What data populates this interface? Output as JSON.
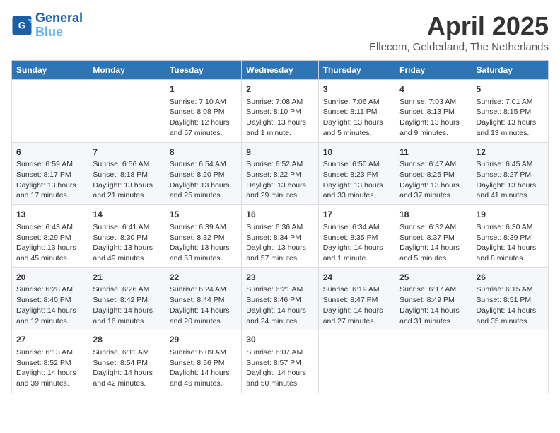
{
  "header": {
    "logo_line1": "General",
    "logo_line2": "Blue",
    "title": "April 2025",
    "location": "Ellecom, Gelderland, The Netherlands"
  },
  "weekdays": [
    "Sunday",
    "Monday",
    "Tuesday",
    "Wednesday",
    "Thursday",
    "Friday",
    "Saturday"
  ],
  "weeks": [
    [
      {
        "day": "",
        "info": ""
      },
      {
        "day": "",
        "info": ""
      },
      {
        "day": "1",
        "info": "Sunrise: 7:10 AM\nSunset: 8:08 PM\nDaylight: 12 hours and 57 minutes."
      },
      {
        "day": "2",
        "info": "Sunrise: 7:08 AM\nSunset: 8:10 PM\nDaylight: 13 hours and 1 minute."
      },
      {
        "day": "3",
        "info": "Sunrise: 7:06 AM\nSunset: 8:11 PM\nDaylight: 13 hours and 5 minutes."
      },
      {
        "day": "4",
        "info": "Sunrise: 7:03 AM\nSunset: 8:13 PM\nDaylight: 13 hours and 9 minutes."
      },
      {
        "day": "5",
        "info": "Sunrise: 7:01 AM\nSunset: 8:15 PM\nDaylight: 13 hours and 13 minutes."
      }
    ],
    [
      {
        "day": "6",
        "info": "Sunrise: 6:59 AM\nSunset: 8:17 PM\nDaylight: 13 hours and 17 minutes."
      },
      {
        "day": "7",
        "info": "Sunrise: 6:56 AM\nSunset: 8:18 PM\nDaylight: 13 hours and 21 minutes."
      },
      {
        "day": "8",
        "info": "Sunrise: 6:54 AM\nSunset: 8:20 PM\nDaylight: 13 hours and 25 minutes."
      },
      {
        "day": "9",
        "info": "Sunrise: 6:52 AM\nSunset: 8:22 PM\nDaylight: 13 hours and 29 minutes."
      },
      {
        "day": "10",
        "info": "Sunrise: 6:50 AM\nSunset: 8:23 PM\nDaylight: 13 hours and 33 minutes."
      },
      {
        "day": "11",
        "info": "Sunrise: 6:47 AM\nSunset: 8:25 PM\nDaylight: 13 hours and 37 minutes."
      },
      {
        "day": "12",
        "info": "Sunrise: 6:45 AM\nSunset: 8:27 PM\nDaylight: 13 hours and 41 minutes."
      }
    ],
    [
      {
        "day": "13",
        "info": "Sunrise: 6:43 AM\nSunset: 8:29 PM\nDaylight: 13 hours and 45 minutes."
      },
      {
        "day": "14",
        "info": "Sunrise: 6:41 AM\nSunset: 8:30 PM\nDaylight: 13 hours and 49 minutes."
      },
      {
        "day": "15",
        "info": "Sunrise: 6:39 AM\nSunset: 8:32 PM\nDaylight: 13 hours and 53 minutes."
      },
      {
        "day": "16",
        "info": "Sunrise: 6:36 AM\nSunset: 8:34 PM\nDaylight: 13 hours and 57 minutes."
      },
      {
        "day": "17",
        "info": "Sunrise: 6:34 AM\nSunset: 8:35 PM\nDaylight: 14 hours and 1 minute."
      },
      {
        "day": "18",
        "info": "Sunrise: 6:32 AM\nSunset: 8:37 PM\nDaylight: 14 hours and 5 minutes."
      },
      {
        "day": "19",
        "info": "Sunrise: 6:30 AM\nSunset: 8:39 PM\nDaylight: 14 hours and 8 minutes."
      }
    ],
    [
      {
        "day": "20",
        "info": "Sunrise: 6:28 AM\nSunset: 8:40 PM\nDaylight: 14 hours and 12 minutes."
      },
      {
        "day": "21",
        "info": "Sunrise: 6:26 AM\nSunset: 8:42 PM\nDaylight: 14 hours and 16 minutes."
      },
      {
        "day": "22",
        "info": "Sunrise: 6:24 AM\nSunset: 8:44 PM\nDaylight: 14 hours and 20 minutes."
      },
      {
        "day": "23",
        "info": "Sunrise: 6:21 AM\nSunset: 8:46 PM\nDaylight: 14 hours and 24 minutes."
      },
      {
        "day": "24",
        "info": "Sunrise: 6:19 AM\nSunset: 8:47 PM\nDaylight: 14 hours and 27 minutes."
      },
      {
        "day": "25",
        "info": "Sunrise: 6:17 AM\nSunset: 8:49 PM\nDaylight: 14 hours and 31 minutes."
      },
      {
        "day": "26",
        "info": "Sunrise: 6:15 AM\nSunset: 8:51 PM\nDaylight: 14 hours and 35 minutes."
      }
    ],
    [
      {
        "day": "27",
        "info": "Sunrise: 6:13 AM\nSunset: 8:52 PM\nDaylight: 14 hours and 39 minutes."
      },
      {
        "day": "28",
        "info": "Sunrise: 6:11 AM\nSunset: 8:54 PM\nDaylight: 14 hours and 42 minutes."
      },
      {
        "day": "29",
        "info": "Sunrise: 6:09 AM\nSunset: 8:56 PM\nDaylight: 14 hours and 46 minutes."
      },
      {
        "day": "30",
        "info": "Sunrise: 6:07 AM\nSunset: 8:57 PM\nDaylight: 14 hours and 50 minutes."
      },
      {
        "day": "",
        "info": ""
      },
      {
        "day": "",
        "info": ""
      },
      {
        "day": "",
        "info": ""
      }
    ]
  ]
}
